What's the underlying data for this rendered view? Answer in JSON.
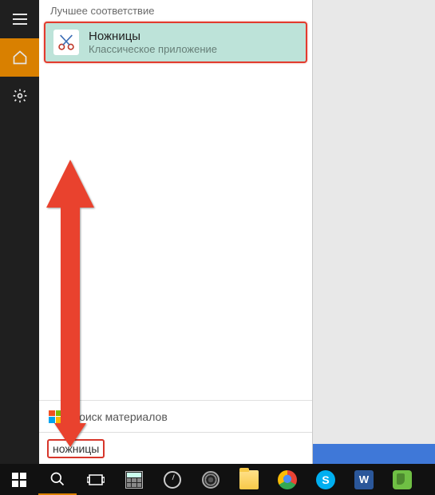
{
  "section_header": "Лучшее соответствие",
  "result": {
    "title": "Ножницы",
    "subtitle": "Классическое приложение"
  },
  "store_row": {
    "label": "Поиск материалов"
  },
  "search": {
    "query": "ножницы"
  },
  "rail": {
    "hamburger": "hamburger-icon",
    "home": "home-icon",
    "settings": "gear-icon"
  },
  "taskbar": {
    "start": "start-icon",
    "search": "search-icon",
    "taskview": "task-view-icon",
    "apps": [
      "calculator",
      "clock",
      "disc",
      "file-explorer",
      "chrome",
      "skype",
      "word",
      "evernote"
    ]
  }
}
